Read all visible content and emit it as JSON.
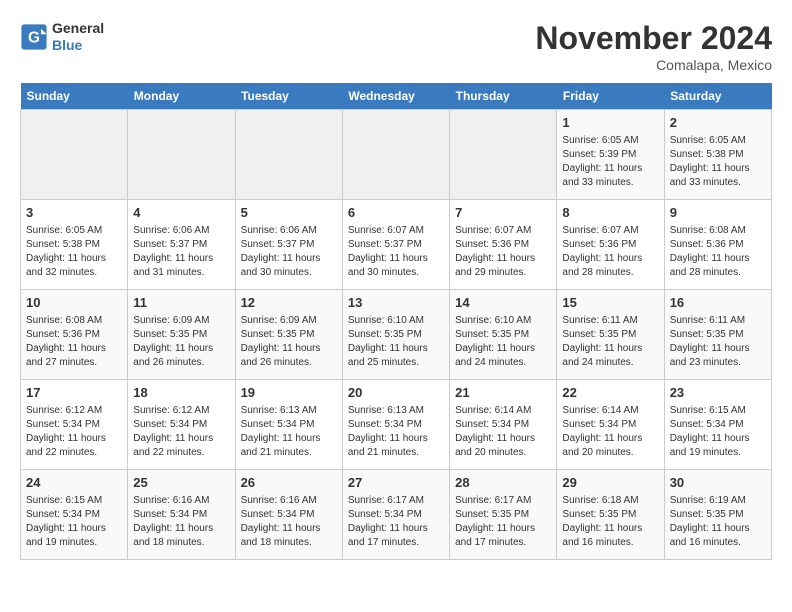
{
  "logo": {
    "line1": "General",
    "line2": "Blue"
  },
  "title": "November 2024",
  "location": "Comalapa, Mexico",
  "weekdays": [
    "Sunday",
    "Monday",
    "Tuesday",
    "Wednesday",
    "Thursday",
    "Friday",
    "Saturday"
  ],
  "weeks": [
    [
      {
        "day": "",
        "empty": true
      },
      {
        "day": "",
        "empty": true
      },
      {
        "day": "",
        "empty": true
      },
      {
        "day": "",
        "empty": true
      },
      {
        "day": "",
        "empty": true
      },
      {
        "day": "1",
        "sunrise": "6:05 AM",
        "sunset": "5:39 PM",
        "daylight": "11 hours and 33 minutes."
      },
      {
        "day": "2",
        "sunrise": "6:05 AM",
        "sunset": "5:38 PM",
        "daylight": "11 hours and 33 minutes."
      }
    ],
    [
      {
        "day": "3",
        "sunrise": "6:05 AM",
        "sunset": "5:38 PM",
        "daylight": "11 hours and 32 minutes."
      },
      {
        "day": "4",
        "sunrise": "6:06 AM",
        "sunset": "5:37 PM",
        "daylight": "11 hours and 31 minutes."
      },
      {
        "day": "5",
        "sunrise": "6:06 AM",
        "sunset": "5:37 PM",
        "daylight": "11 hours and 30 minutes."
      },
      {
        "day": "6",
        "sunrise": "6:07 AM",
        "sunset": "5:37 PM",
        "daylight": "11 hours and 30 minutes."
      },
      {
        "day": "7",
        "sunrise": "6:07 AM",
        "sunset": "5:36 PM",
        "daylight": "11 hours and 29 minutes."
      },
      {
        "day": "8",
        "sunrise": "6:07 AM",
        "sunset": "5:36 PM",
        "daylight": "11 hours and 28 minutes."
      },
      {
        "day": "9",
        "sunrise": "6:08 AM",
        "sunset": "5:36 PM",
        "daylight": "11 hours and 28 minutes."
      }
    ],
    [
      {
        "day": "10",
        "sunrise": "6:08 AM",
        "sunset": "5:36 PM",
        "daylight": "11 hours and 27 minutes."
      },
      {
        "day": "11",
        "sunrise": "6:09 AM",
        "sunset": "5:35 PM",
        "daylight": "11 hours and 26 minutes."
      },
      {
        "day": "12",
        "sunrise": "6:09 AM",
        "sunset": "5:35 PM",
        "daylight": "11 hours and 26 minutes."
      },
      {
        "day": "13",
        "sunrise": "6:10 AM",
        "sunset": "5:35 PM",
        "daylight": "11 hours and 25 minutes."
      },
      {
        "day": "14",
        "sunrise": "6:10 AM",
        "sunset": "5:35 PM",
        "daylight": "11 hours and 24 minutes."
      },
      {
        "day": "15",
        "sunrise": "6:11 AM",
        "sunset": "5:35 PM",
        "daylight": "11 hours and 24 minutes."
      },
      {
        "day": "16",
        "sunrise": "6:11 AM",
        "sunset": "5:35 PM",
        "daylight": "11 hours and 23 minutes."
      }
    ],
    [
      {
        "day": "17",
        "sunrise": "6:12 AM",
        "sunset": "5:34 PM",
        "daylight": "11 hours and 22 minutes."
      },
      {
        "day": "18",
        "sunrise": "6:12 AM",
        "sunset": "5:34 PM",
        "daylight": "11 hours and 22 minutes."
      },
      {
        "day": "19",
        "sunrise": "6:13 AM",
        "sunset": "5:34 PM",
        "daylight": "11 hours and 21 minutes."
      },
      {
        "day": "20",
        "sunrise": "6:13 AM",
        "sunset": "5:34 PM",
        "daylight": "11 hours and 21 minutes."
      },
      {
        "day": "21",
        "sunrise": "6:14 AM",
        "sunset": "5:34 PM",
        "daylight": "11 hours and 20 minutes."
      },
      {
        "day": "22",
        "sunrise": "6:14 AM",
        "sunset": "5:34 PM",
        "daylight": "11 hours and 20 minutes."
      },
      {
        "day": "23",
        "sunrise": "6:15 AM",
        "sunset": "5:34 PM",
        "daylight": "11 hours and 19 minutes."
      }
    ],
    [
      {
        "day": "24",
        "sunrise": "6:15 AM",
        "sunset": "5:34 PM",
        "daylight": "11 hours and 19 minutes."
      },
      {
        "day": "25",
        "sunrise": "6:16 AM",
        "sunset": "5:34 PM",
        "daylight": "11 hours and 18 minutes."
      },
      {
        "day": "26",
        "sunrise": "6:16 AM",
        "sunset": "5:34 PM",
        "daylight": "11 hours and 18 minutes."
      },
      {
        "day": "27",
        "sunrise": "6:17 AM",
        "sunset": "5:34 PM",
        "daylight": "11 hours and 17 minutes."
      },
      {
        "day": "28",
        "sunrise": "6:17 AM",
        "sunset": "5:35 PM",
        "daylight": "11 hours and 17 minutes."
      },
      {
        "day": "29",
        "sunrise": "6:18 AM",
        "sunset": "5:35 PM",
        "daylight": "11 hours and 16 minutes."
      },
      {
        "day": "30",
        "sunrise": "6:19 AM",
        "sunset": "5:35 PM",
        "daylight": "11 hours and 16 minutes."
      }
    ]
  ]
}
